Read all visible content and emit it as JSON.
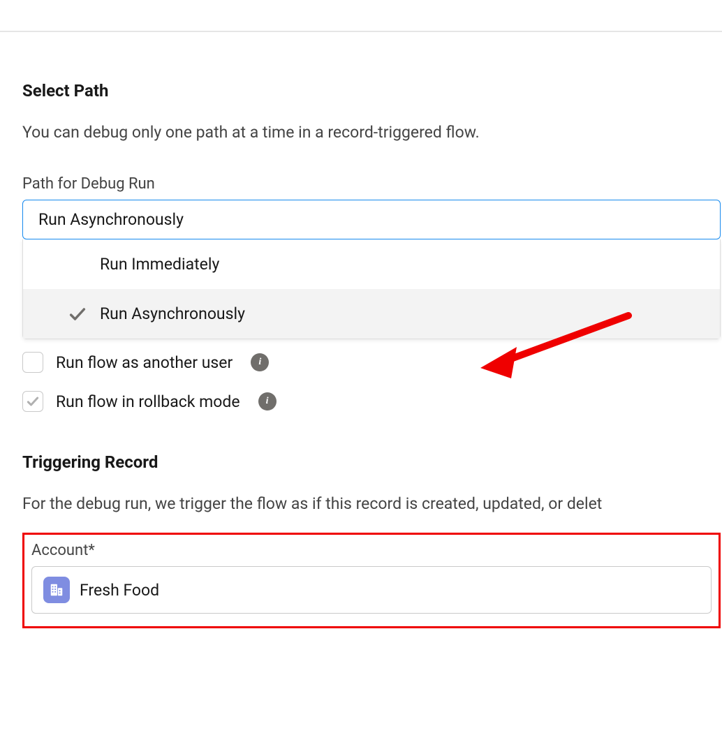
{
  "sections": {
    "selectPath": {
      "title": "Select Path",
      "description": "You can debug only one path at a time in a record-triggered flow."
    },
    "triggeringRecord": {
      "title": "Triggering Record",
      "description": "For the debug run, we trigger the flow as if this record is created, updated, or delet"
    }
  },
  "pathField": {
    "label": "Path for Debug Run",
    "selected": "Run Asynchronously",
    "options": [
      {
        "label": "Run Immediately",
        "selected": false
      },
      {
        "label": "Run Asynchronously",
        "selected": true
      }
    ]
  },
  "checkboxes": {
    "runAsUser": {
      "label": "Run flow as another user",
      "checked": false
    },
    "rollbackMode": {
      "label": "Run flow in rollback mode",
      "checked": true
    }
  },
  "accountField": {
    "label": "Account*",
    "value": "Fresh Food"
  }
}
